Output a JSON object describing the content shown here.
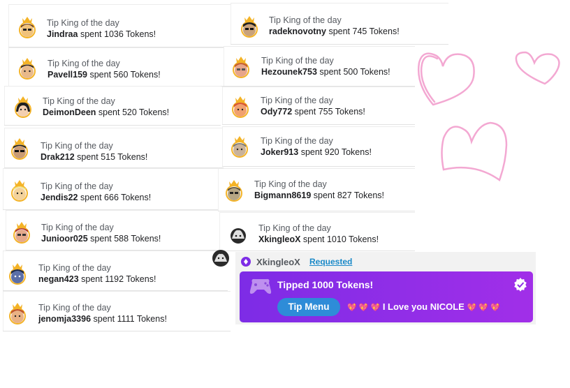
{
  "left_column": [
    {
      "title": "Tip King of the day",
      "user": "Jindraa",
      "amount_text": "spent 1036 Tokens!",
      "avatar": {
        "skin": "#f0c27b",
        "hair": "#6b3d1e"
      }
    },
    {
      "title": "Tip King of the day",
      "user": "Pavell159",
      "amount_text": "spent 560 Tokens!",
      "avatar": {
        "skin": "#e8b98a",
        "hair": "#3a2b22"
      }
    },
    {
      "title": "Tip King of the day",
      "user": "DeimonDeen",
      "amount_text": "spent 520 Tokens!",
      "avatar": {
        "skin": "#f3cfb0",
        "hair": "#202020"
      }
    },
    {
      "title": "Tip King of the day",
      "user": "Drak212",
      "amount_text": "spent 515 Tokens!",
      "avatar": {
        "skin": "#c99b74",
        "hair": "#222222"
      }
    },
    {
      "title": "Tip King of the day",
      "user": "Jendis22",
      "amount_text": "spent 666 Tokens!",
      "avatar": {
        "skin": "#f3d29b",
        "hair": "#f0e07a"
      }
    },
    {
      "title": "Tip King of the day",
      "user": "Junioor025",
      "amount_text": "spent 588 Tokens!",
      "avatar": {
        "skin": "#e5a98c",
        "hair": "#b2322f"
      }
    },
    {
      "title": "Tip King of the day",
      "user": "negan423",
      "amount_text": "spent 1192 Tokens!",
      "avatar": {
        "skin": "#5c6fa8",
        "hair": "#1f2a4a"
      }
    },
    {
      "title": "Tip King of the day",
      "user": "jenomja3396",
      "amount_text": "spent 1111 Tokens!",
      "avatar": {
        "skin": "#e9b184",
        "hair": "#c0552e"
      }
    }
  ],
  "right_column": [
    {
      "title": "Tip King of the day",
      "user": "radeknovotny",
      "amount_text": "spent 745 Tokens!",
      "avatar": {
        "skin": "#c9a27a",
        "hair": "#1f1f1f"
      }
    },
    {
      "title": "Tip King of the day",
      "user": "Hezounek753",
      "amount_text": "spent 500 Tokens!",
      "avatar": {
        "skin": "#e7a58a",
        "hair": "#c75f2e"
      }
    },
    {
      "title": "Tip King of the day",
      "user": "Ody772",
      "amount_text": "spent 755 Tokens!",
      "avatar": {
        "skin": "#f0a06e",
        "hair": "#d8552f"
      }
    },
    {
      "title": "Tip King of the day",
      "user": "Joker913",
      "amount_text": "spent 920 Tokens!",
      "avatar": {
        "skin": "#c9b29a",
        "hair": "#777777"
      }
    },
    {
      "title": "Tip King of the day",
      "user": "Bigmann8619",
      "amount_text": "spent 827 Tokens!",
      "avatar": {
        "skin": "#b6a684",
        "hair": "#5b4f36"
      }
    },
    {
      "title": "Tip King of the day",
      "user": "XkingleoX",
      "amount_text": "spent 1010 Tokens!",
      "avatar": {
        "skin": "#2a2a2a",
        "hair": "#ffffff"
      }
    }
  ],
  "tip_message": {
    "user": "XkingleoX",
    "status_link": "Requested",
    "headline": "Tipped 1000 Tokens!",
    "tip_menu_button": "Tip Menu",
    "message": "I Love you NICOLE",
    "hearts_before": "💖 💖 💖",
    "hearts_after": "💖 💖 💖"
  },
  "colors": {
    "crown": "#f4b326",
    "ring": "#f4b326",
    "tip_gradient_start": "#7d2ce6",
    "tip_gradient_end": "#a12fe8",
    "tip_menu_button": "#2e8cd8",
    "requested_link": "#1a89c8",
    "doodle_heart": "#f3a8d2"
  },
  "icons": {
    "crown": "crown-icon",
    "verified": "verified-badge-icon",
    "diamond": "diamond-icon",
    "gamepad": "gamepad-icon"
  }
}
